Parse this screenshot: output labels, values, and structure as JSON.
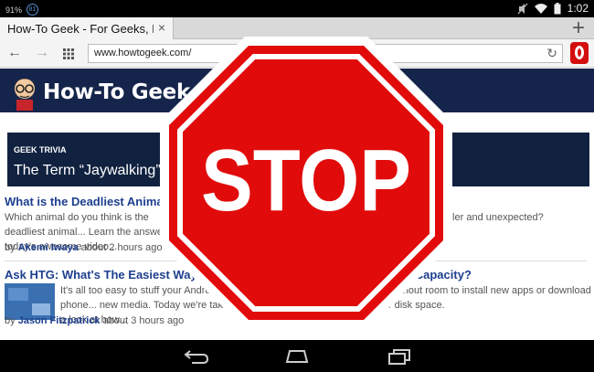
{
  "status_bar": {
    "battery": "91%",
    "notification_count": "81",
    "time": "1:02"
  },
  "tab": {
    "title": "How-To Geek - For Geeks, By Geek",
    "close": "×",
    "new_tab": "+"
  },
  "nav": {
    "back": "←",
    "forward": "→",
    "url": "www.howtogeek.com/",
    "reload": "↻"
  },
  "site": {
    "logo_text": "How-To Geek"
  },
  "trivia": {
    "kicker": "GEEK TRIVIA",
    "title": "The Term “Jaywalking” Derived..."
  },
  "articles": [
    {
      "title": "What is the Deadliest Animal in the World?",
      "body_left": "Which animal do you think is the deadliest animal... Learn the answer in today's awesome video...",
      "body_right": "...something a bit smaller and unexpected?",
      "author_prefix": "by",
      "author": "Akemi Iwaya",
      "time": "about 2 hours ago"
    },
    {
      "title": "Ask HTG: What's The Easiest Way To See What's Using All Your Storage Capacity?",
      "body_left": "It's all too easy to stuff your Android phone... new media. Today we're taking a look at how...",
      "body_right": "...self without room to install new apps or download ...your disk space.",
      "author_prefix": "by",
      "author": "Jason Fitzpatrick",
      "time": "about 3 hours ago"
    }
  ],
  "stop_sign": {
    "text": "STOP"
  },
  "colors": {
    "stop_red": "#e10b0b",
    "header_navy": "#15244a",
    "link_blue": "#1d3f8f"
  }
}
